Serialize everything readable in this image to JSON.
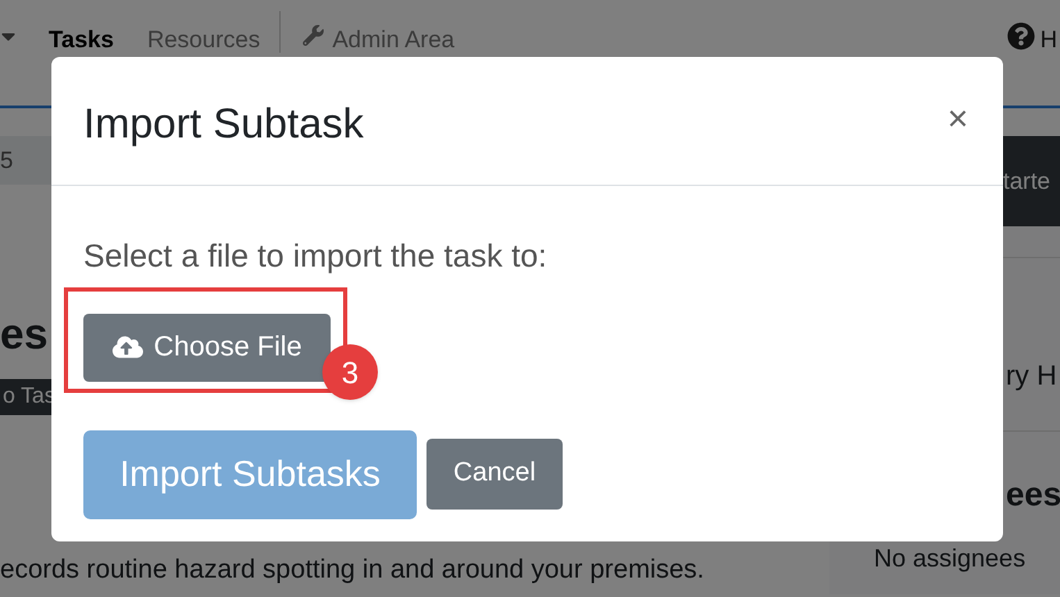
{
  "nav": {
    "items": [
      {
        "label": "Tasks",
        "selected": true
      },
      {
        "label": "Resources",
        "selected": false
      }
    ],
    "admin": "Admin Area",
    "help": "H"
  },
  "breadcrumb": "5",
  "heading": "es",
  "add_button": "o Tas",
  "description": "ecords routine hazard spotting in and around your premises.",
  "side": {
    "start_button": "tarte",
    "text": "ry H",
    "assignees_title": "ees",
    "assignees_empty": "No assignees"
  },
  "modal": {
    "title": "Import Subtask",
    "close": "×",
    "prompt": "Select a file to import the task to:",
    "choose_button": "Choose File",
    "annotation": {
      "number": "3"
    },
    "primary_button": {
      "label": "Import Subtasks",
      "disabled": true
    },
    "cancel_button": "Cancel"
  }
}
